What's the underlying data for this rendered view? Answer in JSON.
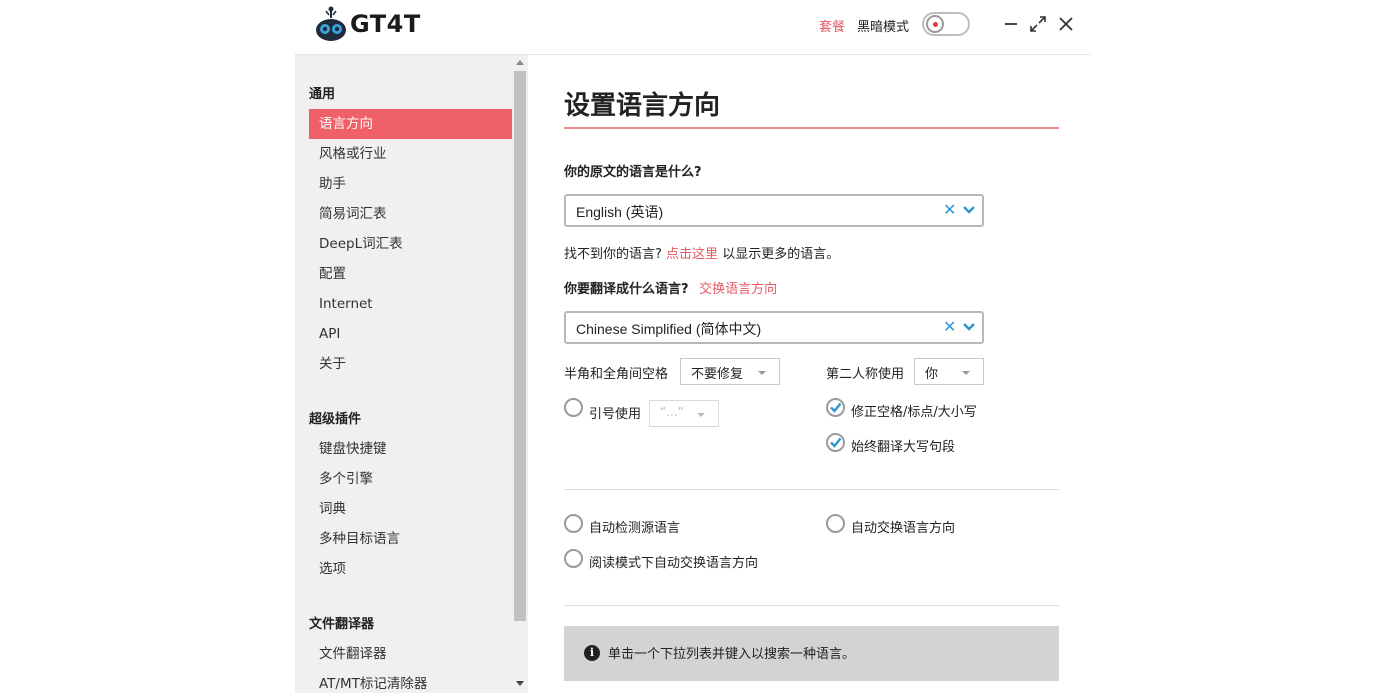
{
  "header": {
    "logo_text": "GT4T",
    "plan_link": "套餐",
    "dark_mode_label": "黑暗模式",
    "dark_mode_enabled": false,
    "accent_color": "#f06068",
    "link_color": "#e65a64",
    "icons": {
      "minimize": "minimize-icon",
      "maximize": "maximize-icon",
      "close": "close-icon"
    }
  },
  "sidebar": {
    "sections": [
      {
        "title": "通用",
        "items": [
          "语言方向",
          "风格或行业",
          "助手",
          "简易词汇表",
          "DeepL词汇表",
          "配置",
          "Internet",
          "API",
          "关于"
        ]
      },
      {
        "title": "超级插件",
        "items": [
          "键盘快捷键",
          "多个引擎",
          "词典",
          "多种目标语言",
          "选项"
        ]
      },
      {
        "title": "文件翻译器",
        "items": [
          "文件翻译器",
          "AT/MT标记清除器"
        ]
      }
    ],
    "active_item": "语言方向"
  },
  "main": {
    "title": "设置语言方向",
    "source_question": "你的原文的语言是什么?",
    "source_language": "English (英语)",
    "hint_prefix": "找不到你的语言?",
    "hint_link": "点击这里",
    "hint_suffix": "以显示更多的语言。",
    "target_question": "你要翻译成什么语言?",
    "swap_link": "交换语言方向",
    "target_language": "Chinese Simplified (简体中文)",
    "options": {
      "space_label": "半角和全角间空格",
      "space_value": "不要修复",
      "second_person_label": "第二人称使用",
      "second_person_value": "你",
      "quote_label": "引号使用",
      "quote_value": "“...”",
      "quote_checked": false,
      "fix_spacing_label": "修正空格/标点/大小写",
      "fix_spacing_checked": true,
      "caps_label": "始终翻译大写句段",
      "caps_checked": true
    },
    "auto": {
      "detect_source_label": "自动检测源语言",
      "detect_source_checked": false,
      "auto_swap_label": "自动交换语言方向",
      "auto_swap_checked": false,
      "reading_swap_label": "阅读模式下自动交换语言方向",
      "reading_swap_checked": false
    },
    "info_text": "单击一个下拉列表并键入以搜索一种语言。",
    "icons": {
      "clear": "clear-icon",
      "dropdown": "chevron-down-icon",
      "info": "info-icon",
      "check": "check-icon"
    }
  }
}
